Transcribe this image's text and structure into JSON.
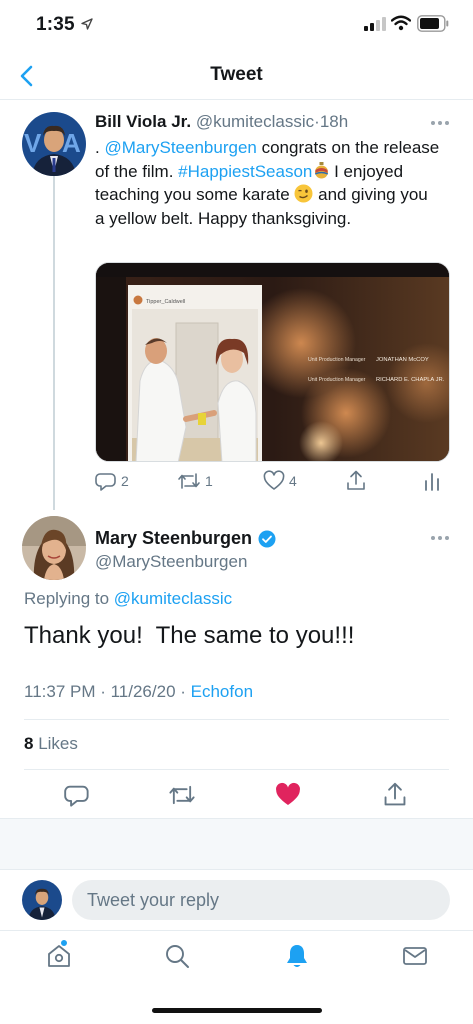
{
  "status_bar": {
    "time": "1:35"
  },
  "nav": {
    "title": "Tweet"
  },
  "parent_tweet": {
    "author_name": "Bill Viola Jr.",
    "author_handle": "@kumiteclassic",
    "separator": "·",
    "age": "18h",
    "text_prefix": ". ",
    "mention": "@MarySteenburgen",
    "text_mid": " congrats on the release of the film. ",
    "hashtag": "#HappiestSeason",
    "text_suffix": " I enjoyed teaching you some karate ",
    "text_end": " and giving you a yellow belt. Happy thanksgiving.",
    "media": {
      "caption_user": "Tipper_Caldwell",
      "credits": [
        {
          "role": "Unit Production Manager",
          "name": "JONATHAN McCOY"
        },
        {
          "role": "Unit Production Manager",
          "name": "RICHARD E. CHAPLA JR."
        }
      ]
    },
    "counts": {
      "replies": "2",
      "retweets": "1",
      "likes": "4"
    }
  },
  "focal_tweet": {
    "author_name": "Mary Steenburgen",
    "author_handle": "@MarySteenburgen",
    "replying_label": "Replying to ",
    "replying_handle": "@kumiteclassic",
    "text": "Thank you!  The same to you!!!",
    "time": "11:37 PM · 11/26/20 · ",
    "source": "Echofon",
    "likes_count": "8",
    "likes_label": " Likes"
  },
  "reply_bar": {
    "placeholder": "Tweet your reply"
  },
  "colors": {
    "accent": "#1da1f2",
    "like_red": "#e0245e",
    "verified": "#1da1f2"
  },
  "icons": {
    "tabs": [
      "home-icon",
      "search-icon",
      "notifications-icon",
      "messages-icon"
    ]
  }
}
